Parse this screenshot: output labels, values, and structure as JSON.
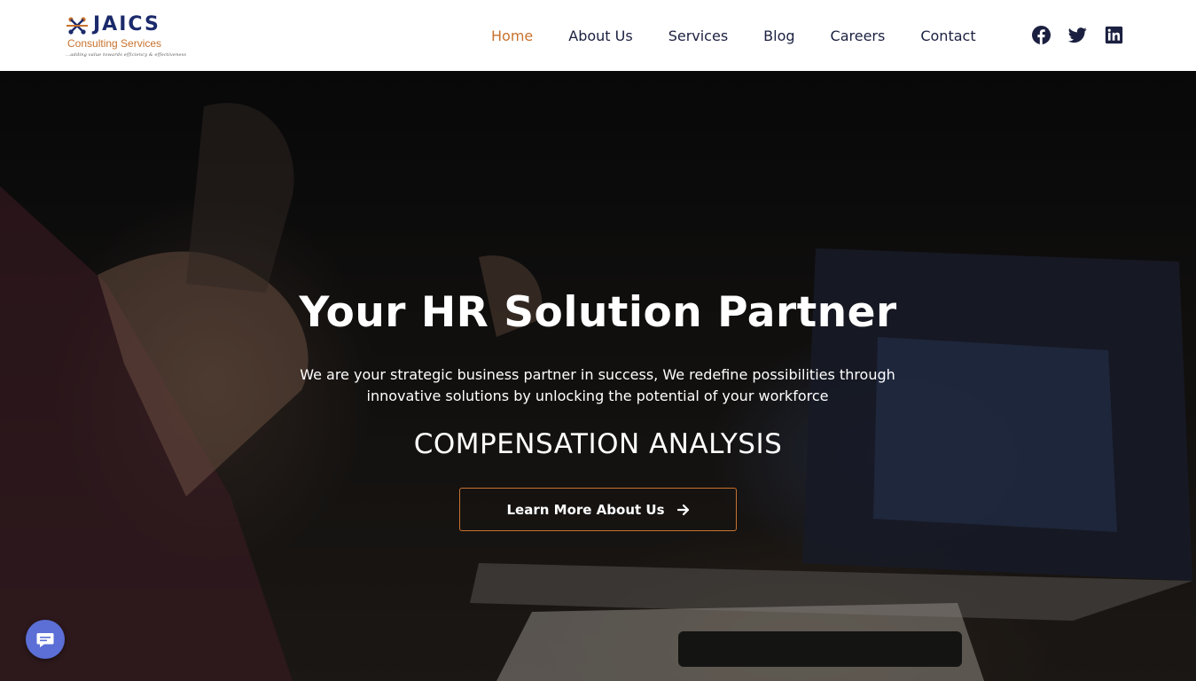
{
  "brand": {
    "name": "JAICS",
    "subtitle": "Consulting Services",
    "tagline": "...adding value towards efficiency & effectiveness"
  },
  "nav": {
    "items": [
      {
        "label": "Home",
        "active": true
      },
      {
        "label": "About Us",
        "active": false
      },
      {
        "label": "Services",
        "active": false
      },
      {
        "label": "Blog",
        "active": false
      },
      {
        "label": "Careers",
        "active": false
      },
      {
        "label": "Contact",
        "active": false
      }
    ]
  },
  "social": [
    "facebook-icon",
    "twitter-icon",
    "linkedin-icon"
  ],
  "hero": {
    "title": "Your HR Solution Partner",
    "text": "We are your strategic business partner in success, We redefine possibilities through innovative solutions by unlocking the potential of your workforce",
    "rotator": "COMPENSATION ANALYSIS",
    "button_label": "Learn More About Us"
  },
  "colors": {
    "accent": "#c9722e",
    "brand_navy": "#1b2a6b",
    "chat": "#5b6fd6"
  }
}
